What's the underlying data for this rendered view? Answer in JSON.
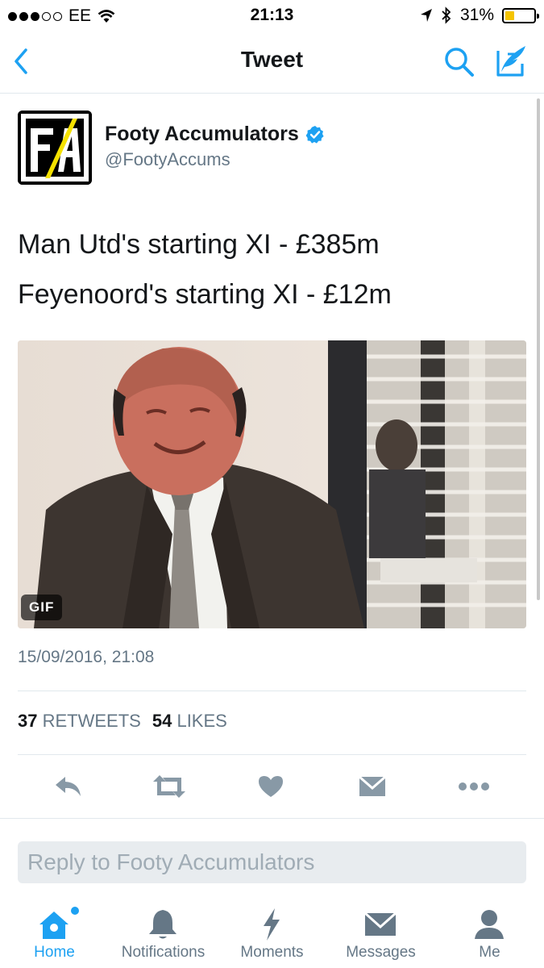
{
  "status_bar": {
    "carrier": "EE",
    "time": "21:13",
    "battery": "31%",
    "battery_level": 0.31
  },
  "nav": {
    "title": "Tweet",
    "back_icon": "chevron-left-icon",
    "search_icon": "search-icon",
    "compose_icon": "compose-icon"
  },
  "tweet": {
    "display_name": "Footy Accumulators",
    "handle": "@FootyAccums",
    "verified": true,
    "text_lines": [
      "Man Utd's starting XI - £385m",
      "Feyenoord's starting XI - £12m"
    ],
    "media_badge": "GIF",
    "timestamp": "15/09/2016, 21:08",
    "retweets_count": "37",
    "retweets_label": "RETWEETS",
    "likes_count": "54",
    "likes_label": "LIKES"
  },
  "actions": [
    {
      "name": "reply-icon"
    },
    {
      "name": "retweet-icon"
    },
    {
      "name": "like-heart-icon"
    },
    {
      "name": "direct-message-icon"
    },
    {
      "name": "more-options-icon"
    }
  ],
  "reply": {
    "placeholder": "Reply to Footy Accumulators"
  },
  "tabs": [
    {
      "label": "Home",
      "icon": "home-icon",
      "active": true
    },
    {
      "label": "Notifications",
      "icon": "bell-icon",
      "active": false
    },
    {
      "label": "Moments",
      "icon": "lightning-icon",
      "active": false
    },
    {
      "label": "Messages",
      "icon": "envelope-icon",
      "active": false
    },
    {
      "label": "Me",
      "icon": "person-icon",
      "active": false
    }
  ],
  "colors": {
    "accent": "#1da1f2",
    "text_primary": "#14171a",
    "text_secondary": "#657786",
    "icon_gray": "#8899a6",
    "avatar_yellow": "#f5e100"
  }
}
